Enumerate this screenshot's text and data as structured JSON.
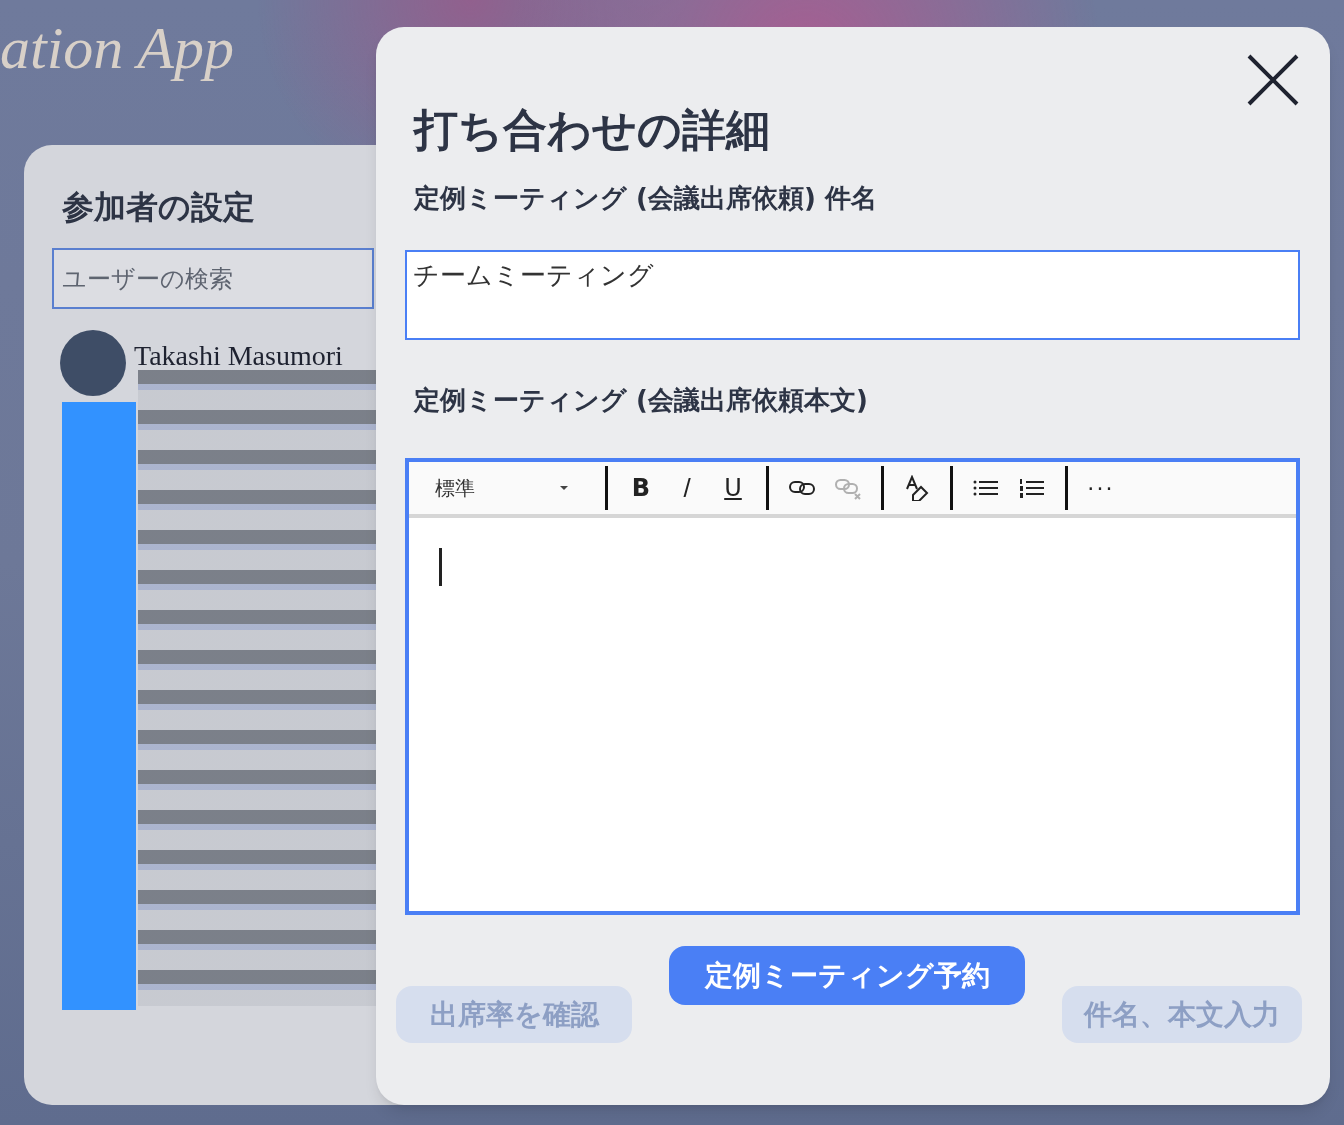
{
  "background": {
    "app_title": "ation App",
    "participants_panel": {
      "title": "参加者の設定",
      "search": {
        "placeholder": "ユーザーの検索"
      },
      "users": [
        {
          "name": "Takashi Masumori"
        }
      ]
    },
    "buttons": [
      {
        "label": "出席率を確認",
        "disabled": true
      },
      {
        "label": "件名、本文入力",
        "disabled": true
      }
    ]
  },
  "dialog": {
    "title": "打ち合わせの詳細",
    "subject": {
      "label": "定例ミーティング (会議出席依頼) 件名",
      "value": "チームミーティング"
    },
    "body": {
      "label": "定例ミーティング (会議出席依頼本文)",
      "style_dropdown": "標準",
      "toolbar": [
        [
          {
            "kind": "bold",
            "label": "B",
            "disabled": false
          },
          {
            "kind": "italic",
            "label": "/",
            "disabled": false
          },
          {
            "kind": "underline",
            "label": "U",
            "disabled": false
          }
        ],
        [
          {
            "kind": "link",
            "disabled": false
          },
          {
            "kind": "unlink",
            "disabled": true
          }
        ],
        [
          {
            "kind": "clear_format",
            "disabled": false
          }
        ],
        [
          {
            "kind": "bullet_list",
            "disabled": false
          },
          {
            "kind": "numbered_list",
            "disabled": false
          }
        ],
        [
          {
            "kind": "more",
            "label": "···",
            "disabled": false
          }
        ]
      ]
    },
    "primary_button": "定例ミーティング予約"
  }
}
